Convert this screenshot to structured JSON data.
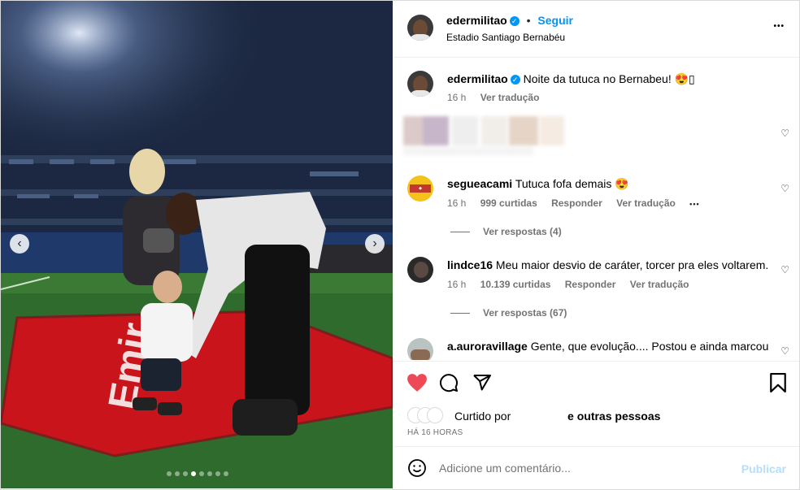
{
  "carousel": {
    "total": 8,
    "active": 4,
    "prev_glyph": "‹",
    "next_glyph": "›"
  },
  "post": {
    "username": "edermilitao",
    "follow_label": "Seguir",
    "separator": "•",
    "location": "Estadio Santiago Bernabéu",
    "more_glyph": "•••",
    "caption": "Noite da tutuca no Bernabeu! 😍▯",
    "caption_time": "16 h",
    "caption_translate": "Ver tradução"
  },
  "comments": [
    {
      "username": "segueacami",
      "text": "Tutuca fofa demais 😍",
      "time": "16 h",
      "likes": "999 curtidas",
      "reply": "Responder",
      "translate": "Ver tradução",
      "more": "•••",
      "view_replies": "Ver respostas (4)"
    },
    {
      "username": "lindce16",
      "text": "Meu maior desvio de caráter, torcer pra eles voltarem.",
      "time": "16 h",
      "likes": "10.139 curtidas",
      "reply": "Responder",
      "translate": "Ver tradução",
      "view_replies": "Ver respostas (67)"
    },
    {
      "username": "a.auroravillage",
      "text": "Gente, que evolução.... Postou e ainda marcou"
    }
  ],
  "liked_by": {
    "prefix": "Curtido por",
    "suffix": "e outras pessoas"
  },
  "post_time": "HÁ 16 HORAS",
  "add_comment": {
    "placeholder": "Adicione um comentário...",
    "publish": "Publicar"
  },
  "colors": {
    "like": "#ed4956",
    "link": "#0095f6",
    "verified": "#0095f6",
    "publish_disabled": "#b2dffc"
  }
}
